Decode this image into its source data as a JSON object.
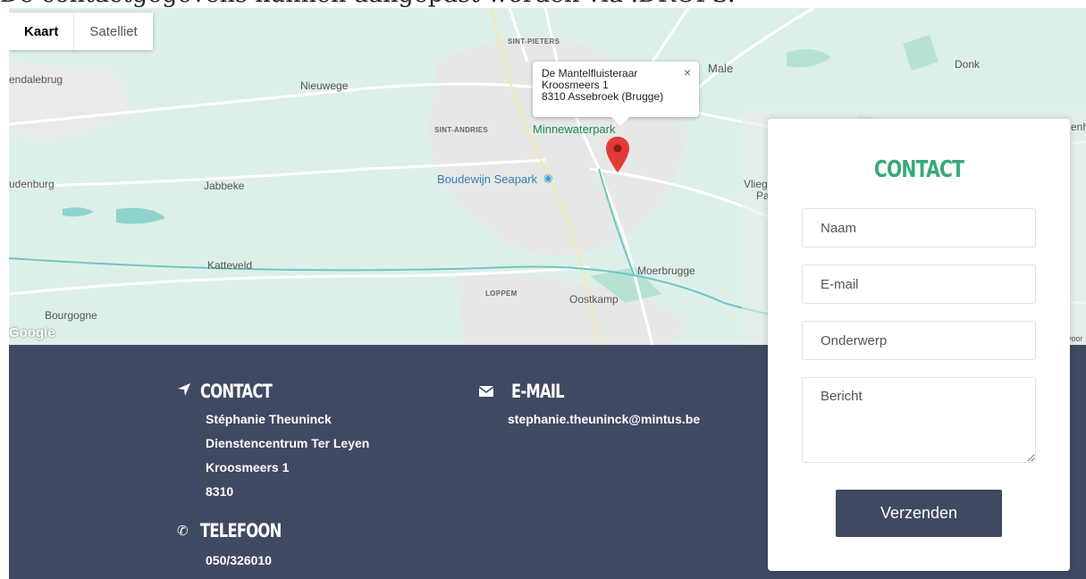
{
  "top_text": "De contactgegevens kunnen aangepast worden via .DROPS.",
  "map": {
    "type_buttons": [
      "Kaart",
      "Satelliet"
    ],
    "places": {
      "sint_pieters": "SINT-PIETERS",
      "male": "Male",
      "donk": "Donk",
      "endalebrug": "endalebrug",
      "nieuwege": "Nieuwege",
      "sint_andries": "SINT-ANDRIES",
      "minnewaterpark": "Minnewaterpark",
      "oudenburg": "udenburg",
      "jabbeke": "Jabbeke",
      "boudewijn": "Boudewijn Seapark",
      "vlieg": "Vlieg",
      "pa": "Pa",
      "enh": "enh",
      "katteveld": "Katteveld",
      "moerbrugge": "Moerbrugge",
      "loppem": "LOPPEM",
      "oostkamp": "Oostkamp",
      "bourgogne": "Bourgogne",
      "voor": "voor"
    },
    "google_logo": "Google",
    "info_window": {
      "title": "De Mantelfluisteraar",
      "line1": "Kroosmeers 1",
      "line2": "8310 Assebroek (Brugge)",
      "close": "×"
    }
  },
  "footer": {
    "contact": {
      "heading": "Contact",
      "lines": [
        "Stéphanie Theuninck",
        "Dienstencentrum Ter Leyen",
        "Kroosmeers 1",
        "8310"
      ]
    },
    "email": {
      "heading": "E-mail",
      "value": "stephanie.theuninck@mintus.be"
    },
    "phone": {
      "heading": "Telefoon",
      "value": "050/326010"
    }
  },
  "form": {
    "heading": "Contact",
    "name_placeholder": "Naam",
    "email_placeholder": "E-mail",
    "subject_placeholder": "Onderwerp",
    "message_placeholder": "Bericht",
    "submit": "Verzenden"
  },
  "colors": {
    "footer_bg": "#3f4a62",
    "accent_green": "#3aa87a",
    "map_bg": "#ddefe9",
    "pin": "#e53935"
  }
}
